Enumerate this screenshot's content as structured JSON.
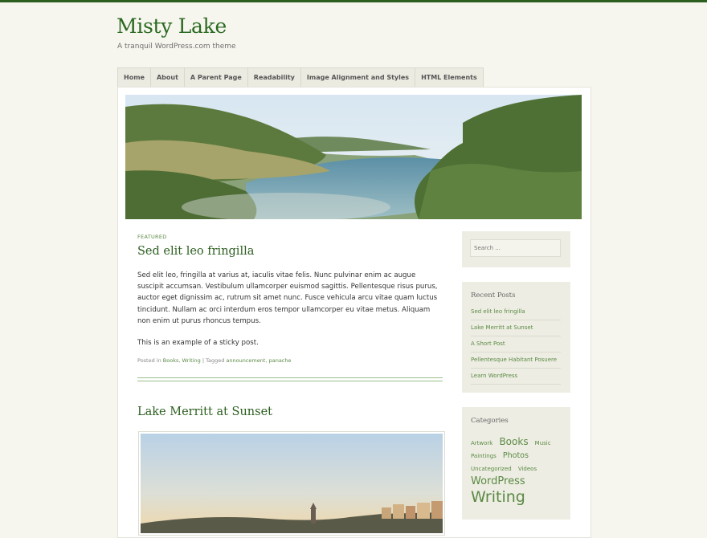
{
  "site": {
    "title": "Misty Lake",
    "description": "A tranquil WordPress.com theme"
  },
  "nav": [
    "Home",
    "About",
    "A Parent Page",
    "Readability",
    "Image Alignment and Styles",
    "HTML Elements"
  ],
  "colors": {
    "accent": "#2b5e1f",
    "link": "#5a8a44",
    "background": "#f7f6ee",
    "widget_bg": "#eeede3"
  },
  "posts": {
    "featured": {
      "label": "FEATURED",
      "title": "Sed elit leo fringilla",
      "paragraph1": "Sed elit leo, fringilla at varius at, iaculis vitae felis. Nunc pulvinar enim ac augue suscipit accumsan. Vestibulum ullamcorper euismod sagittis. Pellentesque risus purus, auctor eget dignissim ac, rutrum sit amet nunc. Fusce vehicula arcu vitae quam luctus tincidunt. Nullam ac orci interdum eros tempor ullamcorper eu vitae metus. Aliquam non enim ut purus rhoncus tempus.",
      "paragraph2": "This is an example of a sticky post.",
      "meta": {
        "posted_in": "Posted in",
        "category1": "Books",
        "comma": ",",
        "category2": "Writing",
        "tagged": "| Tagged",
        "tag1": "announcement",
        "tag2": "panache"
      }
    },
    "second": {
      "title": "Lake Merritt at Sunset"
    }
  },
  "sidebar": {
    "search_placeholder": "Search ...",
    "recent_title": "Recent Posts",
    "recent": [
      "Sed elit leo fringilla",
      "Lake Merritt at Sunset",
      "A Short Post",
      "Pellentesque Habitant Posuere",
      "Learn WordPress"
    ],
    "categories_title": "Categories",
    "categories": [
      "Artwork",
      "Books",
      "Music",
      "Paintings",
      "Photos",
      "Uncategorized",
      "Videos",
      "WordPress",
      "Writing"
    ]
  }
}
